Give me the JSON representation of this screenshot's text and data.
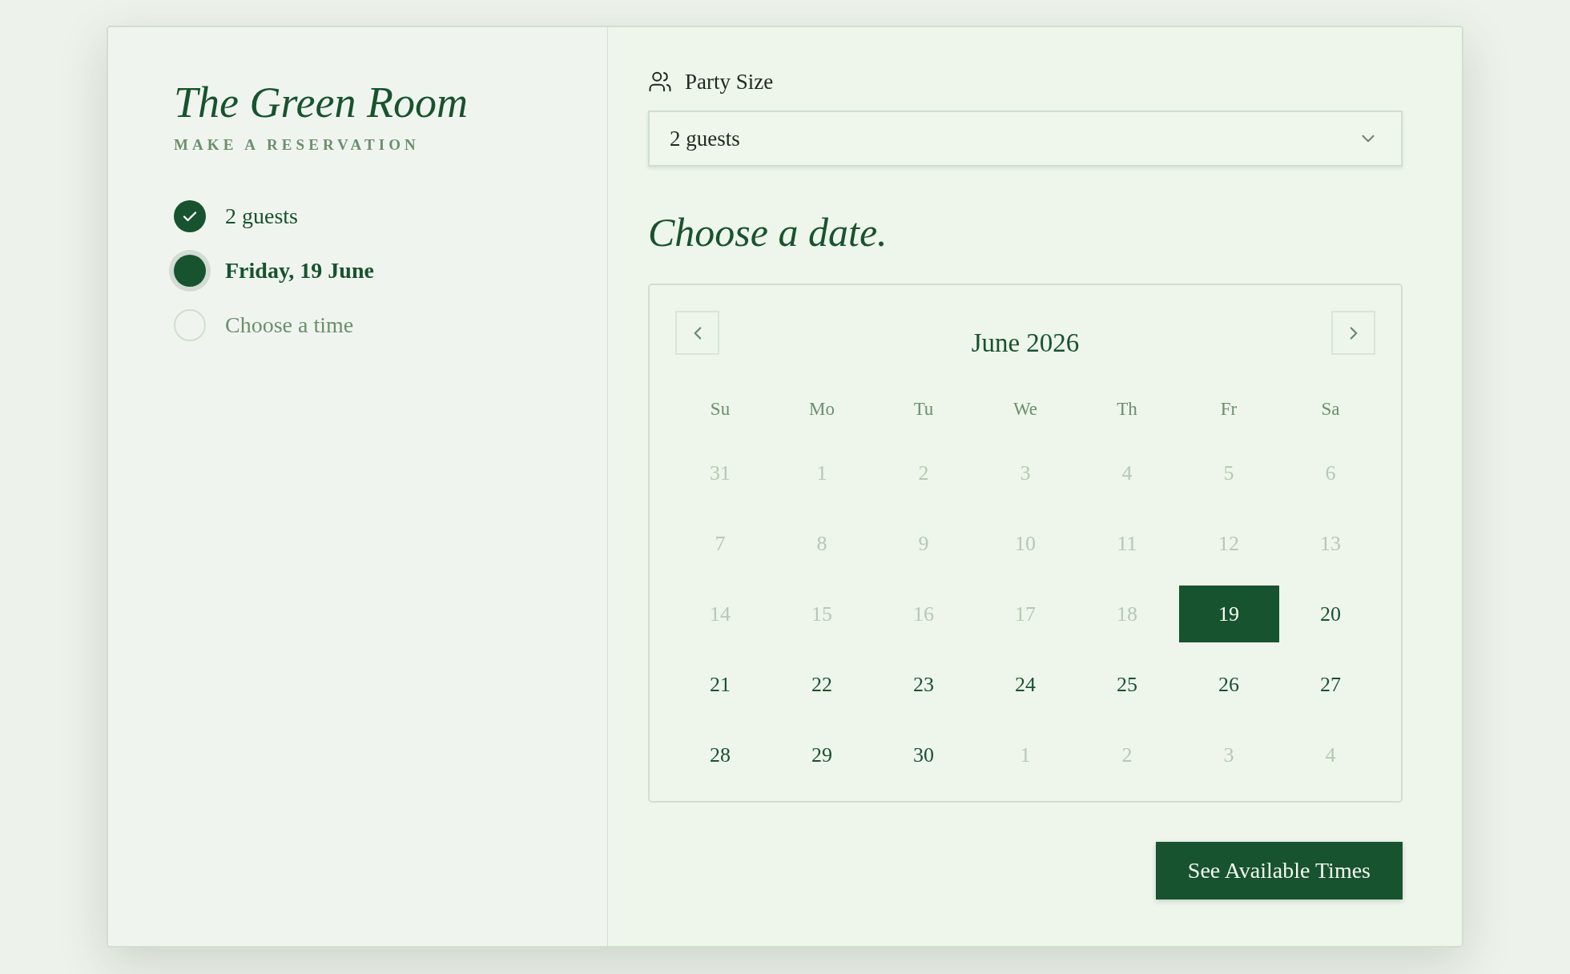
{
  "sidebar": {
    "title": "The Green Room",
    "subtitle": "MAKE A RESERVATION",
    "steps": [
      {
        "label": "2 guests",
        "completed": true,
        "selected": false
      },
      {
        "label": "Friday, 19 June",
        "completed": false,
        "selected": true
      },
      {
        "label": "Choose a time",
        "completed": false,
        "selected": false
      }
    ]
  },
  "party_size": {
    "label": "Party Size",
    "value": "2 guests"
  },
  "heading": "Choose a date.",
  "calendar": {
    "month": "June 2026",
    "weekdays": [
      "Su",
      "Mo",
      "Tu",
      "We",
      "Th",
      "Fr",
      "Sa"
    ],
    "days": [
      {
        "label": "31",
        "disabled": true,
        "selected": false
      },
      {
        "label": "1",
        "disabled": true,
        "selected": false
      },
      {
        "label": "2",
        "disabled": true,
        "selected": false
      },
      {
        "label": "3",
        "disabled": true,
        "selected": false
      },
      {
        "label": "4",
        "disabled": true,
        "selected": false
      },
      {
        "label": "5",
        "disabled": true,
        "selected": false
      },
      {
        "label": "6",
        "disabled": true,
        "selected": false
      },
      {
        "label": "7",
        "disabled": true,
        "selected": false
      },
      {
        "label": "8",
        "disabled": true,
        "selected": false
      },
      {
        "label": "9",
        "disabled": true,
        "selected": false
      },
      {
        "label": "10",
        "disabled": true,
        "selected": false
      },
      {
        "label": "11",
        "disabled": true,
        "selected": false
      },
      {
        "label": "12",
        "disabled": true,
        "selected": false
      },
      {
        "label": "13",
        "disabled": true,
        "selected": false
      },
      {
        "label": "14",
        "disabled": true,
        "selected": false
      },
      {
        "label": "15",
        "disabled": true,
        "selected": false
      },
      {
        "label": "16",
        "disabled": true,
        "selected": false
      },
      {
        "label": "17",
        "disabled": true,
        "selected": false
      },
      {
        "label": "18",
        "disabled": true,
        "selected": false
      },
      {
        "label": "19",
        "disabled": false,
        "selected": true
      },
      {
        "label": "20",
        "disabled": false,
        "selected": false
      },
      {
        "label": "21",
        "disabled": false,
        "selected": false
      },
      {
        "label": "22",
        "disabled": false,
        "selected": false
      },
      {
        "label": "23",
        "disabled": false,
        "selected": false
      },
      {
        "label": "24",
        "disabled": false,
        "selected": false
      },
      {
        "label": "25",
        "disabled": false,
        "selected": false
      },
      {
        "label": "26",
        "disabled": false,
        "selected": false
      },
      {
        "label": "27",
        "disabled": false,
        "selected": false
      },
      {
        "label": "28",
        "disabled": false,
        "selected": false
      },
      {
        "label": "29",
        "disabled": false,
        "selected": false
      },
      {
        "label": "30",
        "disabled": false,
        "selected": false
      },
      {
        "label": "1",
        "disabled": true,
        "selected": false
      },
      {
        "label": "2",
        "disabled": true,
        "selected": false
      },
      {
        "label": "3",
        "disabled": true,
        "selected": false
      },
      {
        "label": "4",
        "disabled": true,
        "selected": false
      }
    ]
  },
  "button": "See Available Times"
}
